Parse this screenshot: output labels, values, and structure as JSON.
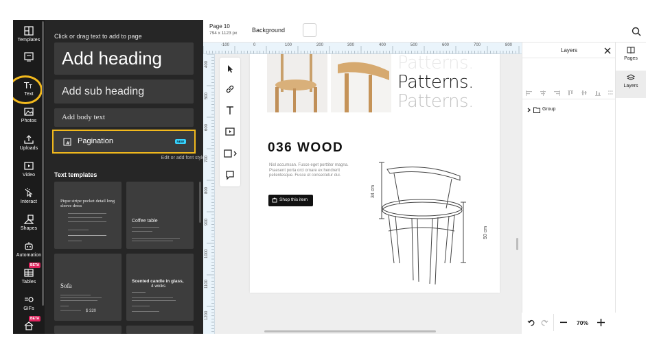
{
  "rail": [
    {
      "label": "Templates",
      "icon": "templates-icon"
    },
    {
      "label": "Text",
      "icon": "text-icon"
    },
    {
      "label": "Photos",
      "icon": "photos-icon"
    },
    {
      "label": "Uploads",
      "icon": "upload-icon"
    },
    {
      "label": "Video",
      "icon": "video-icon"
    },
    {
      "label": "Interact",
      "icon": "interact-icon"
    },
    {
      "label": "Shapes",
      "icon": "shapes-icon"
    },
    {
      "label": "Automation",
      "icon": "automation-icon"
    },
    {
      "label": "Tables",
      "icon": "tables-icon",
      "badge": "BETA"
    },
    {
      "label": "GIFs",
      "icon": "gifs-icon"
    },
    {
      "label": "",
      "icon": "home-icon",
      "badge": "BETA"
    }
  ],
  "panel": {
    "instruction": "Click or drag text to add to page",
    "add_heading": "Add heading",
    "add_sub_heading": "Add sub heading",
    "add_body_text": "Add body text",
    "pagination": "Pagination",
    "new_badge": "NEW",
    "font_styles_link": "Edit or add font styles",
    "templates_title": "Text templates",
    "templates": [
      {
        "title": "Pique stripe pocket detail long sleeve dress"
      },
      {
        "title": "Coffee table"
      },
      {
        "title": "Sofa",
        "price": "$ 320"
      },
      {
        "title": "Scented candle in glass,",
        "subtitle": "4 wicks"
      }
    ]
  },
  "topbar": {
    "page_name": "Page 10",
    "page_size": "794 x 1123 px",
    "background_label": "Background",
    "search_icon": "search-icon"
  },
  "ruler": {
    "top": [
      "-100",
      "0",
      "100",
      "200",
      "300",
      "400",
      "500",
      "600",
      "700",
      "800"
    ],
    "left": [
      "400",
      "500",
      "600",
      "700",
      "800",
      "900",
      "1000",
      "1100",
      "1200"
    ]
  },
  "design": {
    "patterns": [
      "Patterns.",
      "Patterns.",
      "Patterns."
    ],
    "heading": "036 WOOD",
    "body": "Nisl accumsan. Fusce eget porttitor magna. Praesent porta orci ornare ex hendrerit pellentesque. Fusce et consectetur dui.",
    "button": "Shop this item",
    "dim_height": "34 cm",
    "dim_seat": "50 cm"
  },
  "layers": {
    "title": "Layers",
    "items": [
      {
        "label": "Group"
      }
    ],
    "zoom": "70%"
  },
  "rightrail": [
    {
      "label": "Pages"
    },
    {
      "label": "Layers"
    }
  ],
  "colors": {
    "rail_bg": "#1b1b1b",
    "panel_bg": "#262626",
    "highlight": "#f2b91d",
    "new_badge": "#36d3ff",
    "beta_badge": "#e0245e",
    "canvas_bg": "#eeeeee",
    "ruler_bg": "#eaf4fb"
  }
}
